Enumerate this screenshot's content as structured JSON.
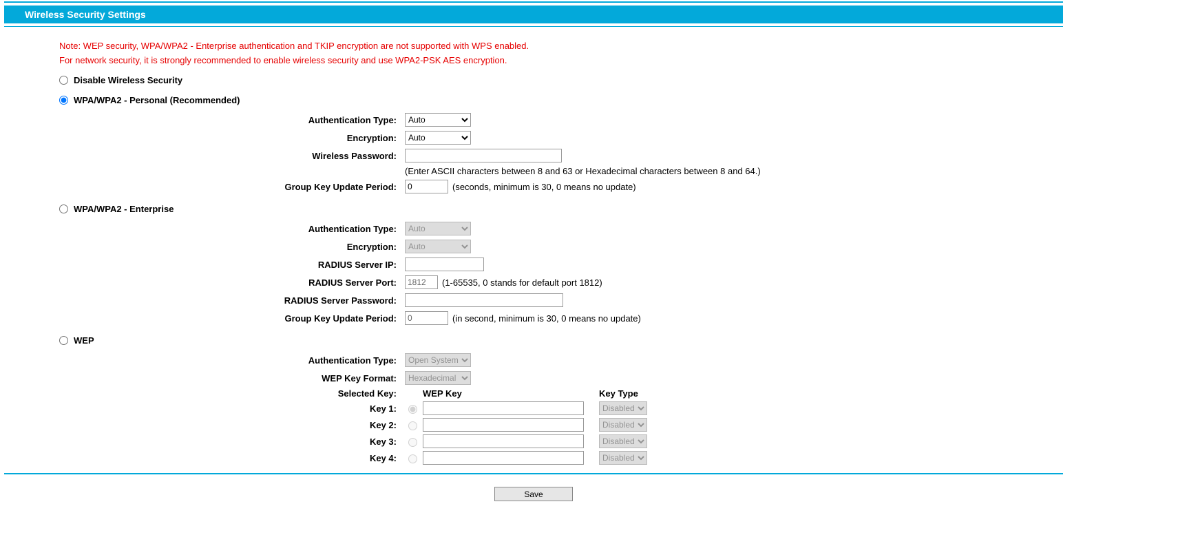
{
  "header": {
    "title": "Wireless Security Settings"
  },
  "notes": {
    "line1": "Note: WEP security, WPA/WPA2 - Enterprise authentication and TKIP encryption are not supported with WPS enabled.",
    "line2": "For network security, it is strongly recommended to enable wireless security and use WPA2-PSK AES encryption."
  },
  "modes": {
    "disable": "Disable Wireless Security",
    "personal": "WPA/WPA2 - Personal (Recommended)",
    "enterprise": "WPA/WPA2 - Enterprise",
    "wep": "WEP"
  },
  "labels": {
    "auth_type": "Authentication Type:",
    "encryption": "Encryption:",
    "wireless_password": "Wireless Password:",
    "group_key": "Group Key Update Period:",
    "radius_ip": "RADIUS Server IP:",
    "radius_port": "RADIUS Server Port:",
    "radius_password": "RADIUS Server Password:",
    "wep_key_format": "WEP Key Format:",
    "selected_key": "Selected Key:",
    "wep_key_col": "WEP Key",
    "key_type_col": "Key Type",
    "key1": "Key 1:",
    "key2": "Key 2:",
    "key3": "Key 3:",
    "key4": "Key 4:"
  },
  "personal": {
    "auth": "Auto",
    "encryption": "Auto",
    "password": "",
    "password_hint": "(Enter ASCII characters between 8 and 63 or Hexadecimal characters between 8 and 64.)",
    "group_key": "0",
    "group_key_hint": "(seconds, minimum is 30, 0 means no update)"
  },
  "enterprise": {
    "auth": "Auto",
    "encryption": "Auto",
    "radius_ip": "",
    "radius_port": "1812",
    "radius_port_hint": "(1-65535, 0 stands for default port 1812)",
    "radius_password": "",
    "group_key": "0",
    "group_key_hint": "(in second, minimum is 30, 0 means no update)"
  },
  "wep": {
    "auth": "Open System",
    "key_format": "Hexadecimal",
    "keys": [
      {
        "label": "Key 1:",
        "value": "",
        "type": "Disabled"
      },
      {
        "label": "Key 2:",
        "value": "",
        "type": "Disabled"
      },
      {
        "label": "Key 3:",
        "value": "",
        "type": "Disabled"
      },
      {
        "label": "Key 4:",
        "value": "",
        "type": "Disabled"
      }
    ]
  },
  "buttons": {
    "save": "Save"
  }
}
